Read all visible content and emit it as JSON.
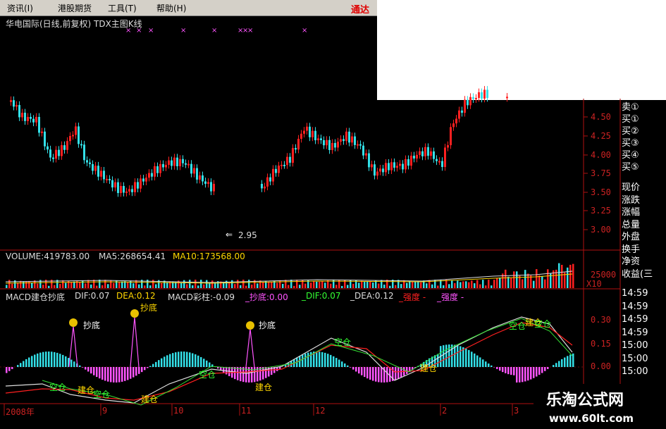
{
  "menu": {
    "items": [
      "资讯(I)",
      "港股期货",
      "工具(T)",
      "帮助(H)"
    ],
    "brand": "通达"
  },
  "chart_title": "华电国际(日线,前复权) TDX主图K线",
  "price_axis": [
    "4.50",
    "4.25",
    "4.00",
    "3.75",
    "3.50",
    "3.25",
    "3.00"
  ],
  "min_price_label": "2.95",
  "volume_info": {
    "vol": "VOLUME:419783.00",
    "ma5": "MA5:268654.41",
    "ma10": "MA10:173568.00"
  },
  "volume_axis": {
    "v": "25000",
    "unit": "X10"
  },
  "macd_info": {
    "name": "MACD建仓抄底",
    "dif": "DIF:0.07",
    "dea": "DEA:0.12",
    "col": "MACD彩柱:-0.09",
    "chaodi": "_抄底:0.00",
    "dif2": "_DIF:0.07",
    "dea2": "_DEA:0.12",
    "s1": "_强度 -",
    "s2": "_强度 -"
  },
  "macd_axis": [
    "0.30",
    "0.15",
    "0.00"
  ],
  "side_panel": {
    "buy": [
      "卖①",
      "买①",
      "买②",
      "买③",
      "买④",
      "买⑤"
    ],
    "stats": [
      "现价",
      "涨跌",
      "涨幅",
      "总量",
      "外盘",
      "换手",
      "净资",
      "收益(三"
    ],
    "times": [
      "14:59",
      "14:59",
      "14:59",
      "14:59",
      "15:00",
      "15:00",
      "15:00"
    ]
  },
  "date_axis": [
    "2008年",
    "9",
    "10",
    "11",
    "12",
    "2",
    "3"
  ],
  "signals": {
    "chaodi": "抄底",
    "jiancang": "建仓",
    "kongcang": "空仓"
  },
  "banner": {
    "name": "乐淘公式网",
    "url": "www.60lt.com"
  },
  "colors": {
    "up": "#ff2020",
    "down": "#33e0e8",
    "bg": "#000000",
    "grid": "#a01010"
  }
}
